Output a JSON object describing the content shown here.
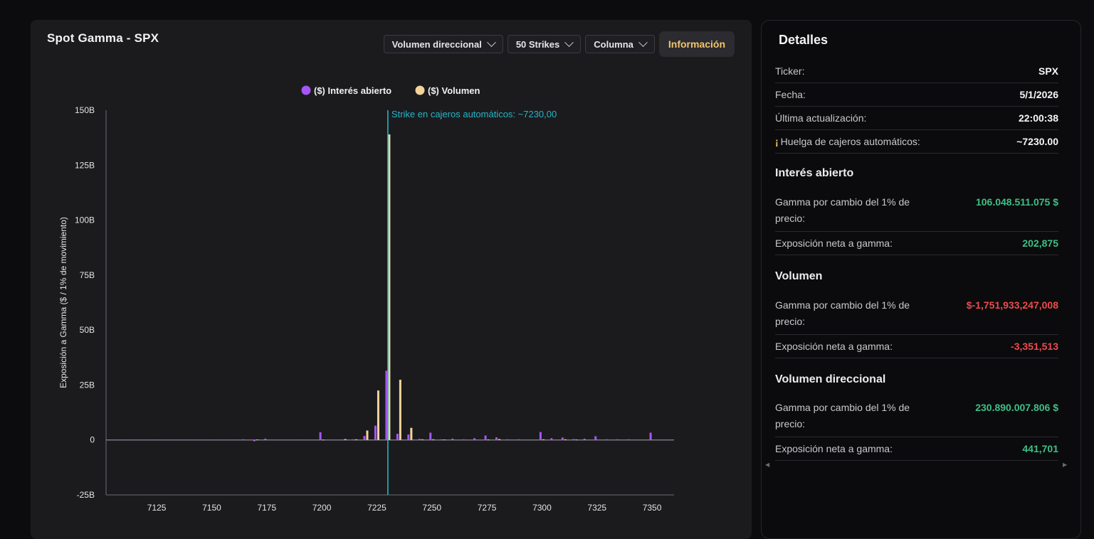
{
  "chart_panel": {
    "title": "Spot Gamma - SPX",
    "dropdowns": [
      {
        "label": "Volumen direccional"
      },
      {
        "label": "50 Strikes"
      },
      {
        "label": "Columna"
      }
    ],
    "info_button": "Información"
  },
  "chart_data": {
    "type": "bar",
    "ylabel": "Exposición a Gamma ($ / 1% de movimiento)",
    "xlabel": "",
    "xlim": [
      7102,
      7360
    ],
    "ylim": [
      -25,
      150
    ],
    "yticks": [
      -25,
      0,
      25,
      50,
      75,
      100,
      125,
      150
    ],
    "ytick_labels": [
      "-25B",
      "0",
      "25B",
      "50B",
      "75B",
      "100B",
      "125B",
      "150B"
    ],
    "xticks": [
      7125,
      7150,
      7175,
      7200,
      7225,
      7250,
      7275,
      7300,
      7325,
      7350
    ],
    "xtick_labels": [
      "7125",
      "7150",
      "7175",
      "7200",
      "7225",
      "7250",
      "7275",
      "7300",
      "7325",
      "7350"
    ],
    "legend_position": "top",
    "atm_strike": 7230,
    "atm_label": "Strike en cajeros automáticos: ~7230,00",
    "series": [
      {
        "name": "($) Interés abierto",
        "color": "#a855f7",
        "points": [
          {
            "x": 7110,
            "y": 0.1
          },
          {
            "x": 7120,
            "y": 0.1
          },
          {
            "x": 7125,
            "y": 0.2
          },
          {
            "x": 7140,
            "y": 0.1
          },
          {
            "x": 7150,
            "y": 0.1
          },
          {
            "x": 7160,
            "y": 0.2
          },
          {
            "x": 7165,
            "y": 0.3
          },
          {
            "x": 7170,
            "y": -0.6
          },
          {
            "x": 7175,
            "y": 0.6
          },
          {
            "x": 7190,
            "y": 0.2
          },
          {
            "x": 7200,
            "y": 3.5
          },
          {
            "x": 7210,
            "y": 0.2
          },
          {
            "x": 7215,
            "y": 0.3
          },
          {
            "x": 7220,
            "y": 1.8
          },
          {
            "x": 7225,
            "y": 6.5
          },
          {
            "x": 7230,
            "y": 31.5
          },
          {
            "x": 7235,
            "y": 2.8
          },
          {
            "x": 7240,
            "y": 2.5
          },
          {
            "x": 7245,
            "y": 0.5
          },
          {
            "x": 7250,
            "y": 3.3
          },
          {
            "x": 7255,
            "y": 0.3
          },
          {
            "x": 7260,
            "y": 0.6
          },
          {
            "x": 7265,
            "y": 0.3
          },
          {
            "x": 7270,
            "y": 0.8
          },
          {
            "x": 7275,
            "y": 2.0
          },
          {
            "x": 7280,
            "y": 1.2
          },
          {
            "x": 7285,
            "y": 0.3
          },
          {
            "x": 7290,
            "y": 0.3
          },
          {
            "x": 7300,
            "y": 3.6
          },
          {
            "x": 7305,
            "y": 0.8
          },
          {
            "x": 7310,
            "y": 1.1
          },
          {
            "x": 7315,
            "y": 0.4
          },
          {
            "x": 7320,
            "y": 0.6
          },
          {
            "x": 7325,
            "y": 1.7
          },
          {
            "x": 7330,
            "y": 0.3
          },
          {
            "x": 7335,
            "y": 0.3
          },
          {
            "x": 7340,
            "y": 0.3
          },
          {
            "x": 7350,
            "y": 3.3
          }
        ]
      },
      {
        "name": "($) Volumen",
        "color": "#f2d49a",
        "points": [
          {
            "x": 7170,
            "y": 0.2
          },
          {
            "x": 7200,
            "y": 0.1
          },
          {
            "x": 7210,
            "y": 0.4
          },
          {
            "x": 7215,
            "y": 0.3
          },
          {
            "x": 7220,
            "y": 4.3
          },
          {
            "x": 7225,
            "y": 22.5
          },
          {
            "x": 7230,
            "y": 139.0
          },
          {
            "x": 7235,
            "y": 27.4
          },
          {
            "x": 7240,
            "y": 5.5
          },
          {
            "x": 7245,
            "y": 0.3
          },
          {
            "x": 7250,
            "y": 0.3
          },
          {
            "x": 7255,
            "y": 0.2
          },
          {
            "x": 7275,
            "y": 0.2
          },
          {
            "x": 7280,
            "y": 0.4
          },
          {
            "x": 7300,
            "y": 0.3
          },
          {
            "x": 7310,
            "y": 0.3
          },
          {
            "x": 7315,
            "y": 0.2
          }
        ]
      }
    ]
  },
  "details": {
    "title": "Detalles",
    "ticker_label": "Ticker:",
    "ticker_value": "SPX",
    "fecha_label": "Fecha:",
    "fecha_value": "5/1/2026",
    "update_label": "Última actualización:",
    "update_value": "22:00:38",
    "huelga_icon": "¡",
    "huelga_label": "Huelga de cajeros automáticos:",
    "huelga_value": "~7230.00",
    "sections": [
      {
        "heading": "Interés abierto",
        "gamma_label": "Gamma por cambio del 1% de precio:",
        "gamma_value": "106.048.511.075 $",
        "net_label": "Exposición neta a gamma:",
        "net_value": "202,875"
      },
      {
        "heading": "Volumen",
        "gamma_label": "Gamma por cambio del 1% de precio:",
        "gamma_value": "$-1,751,933,247,008",
        "net_label": "Exposición neta a gamma:",
        "net_value": "-3,351,513"
      },
      {
        "heading": "Volumen direccional",
        "gamma_label": "Gamma por cambio del 1% de precio:",
        "gamma_value": "230.890.007.806 $",
        "net_label": "Exposición neta a gamma:",
        "net_value": "441,701"
      }
    ],
    "colors": {
      "positive": "#3fbf86",
      "negative": "#ef4b4b"
    }
  }
}
